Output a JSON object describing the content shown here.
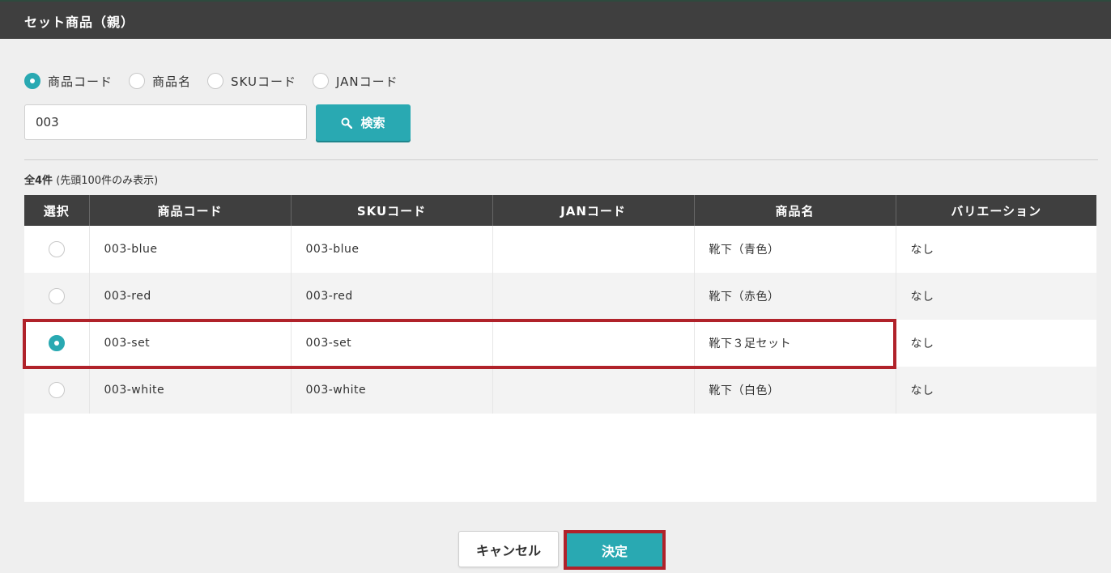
{
  "dialog": {
    "title": "セット商品（親）"
  },
  "search": {
    "options": [
      {
        "label": "商品コード",
        "checked": true
      },
      {
        "label": "商品名",
        "checked": false
      },
      {
        "label": "SKUコード",
        "checked": false
      },
      {
        "label": "JANコード",
        "checked": false
      }
    ],
    "value": "003",
    "button_label": "検索"
  },
  "results": {
    "count_bold": "全4件",
    "count_note": "(先頭100件のみ表示)"
  },
  "table": {
    "headers": [
      "選択",
      "商品コード",
      "SKUコード",
      "JANコード",
      "商品名",
      "バリエーション"
    ],
    "rows": [
      {
        "selected": false,
        "product_code": "003-blue",
        "sku_code": "003-blue",
        "jan_code": "",
        "product_name": "靴下（青色）",
        "variation": "なし"
      },
      {
        "selected": false,
        "product_code": "003-red",
        "sku_code": "003-red",
        "jan_code": "",
        "product_name": "靴下（赤色）",
        "variation": "なし"
      },
      {
        "selected": true,
        "product_code": "003-set",
        "sku_code": "003-set",
        "jan_code": "",
        "product_name": "靴下３足セット",
        "variation": "なし"
      },
      {
        "selected": false,
        "product_code": "003-white",
        "sku_code": "003-white",
        "jan_code": "",
        "product_name": "靴下（白色）",
        "variation": "なし"
      }
    ]
  },
  "footer": {
    "cancel_label": "キャンセル",
    "ok_label": "決定"
  },
  "colors": {
    "accent": "#29a9b2",
    "header_bg": "#3f3f3f",
    "highlight": "#b0222a"
  }
}
